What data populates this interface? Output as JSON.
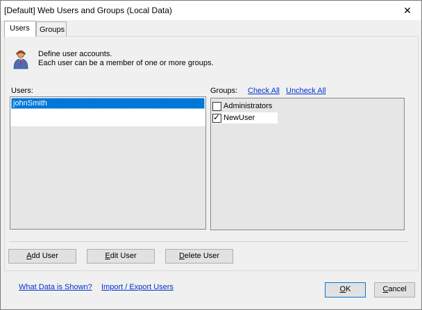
{
  "window": {
    "title": "[Default] Web Users and Groups (Local Data)",
    "close_glyph": "✕"
  },
  "tabs": [
    {
      "label": "Users",
      "active": true
    },
    {
      "label": "Groups",
      "active": false
    }
  ],
  "description": {
    "line1": "Define user accounts.",
    "line2": "Each user can be a member of one or more groups."
  },
  "users": {
    "label": "Users:",
    "items": [
      "johnSmith"
    ],
    "selected": "johnSmith"
  },
  "groups": {
    "label": "Groups:",
    "check_all": "Check All",
    "uncheck_all": "Uncheck All",
    "items": [
      {
        "label": "Administrators",
        "checked": false
      },
      {
        "label": "NewUser",
        "checked": true
      }
    ]
  },
  "buttons": {
    "add_user_pre": "",
    "add_user_ul": "A",
    "add_user_post": "dd User",
    "edit_user_pre": "",
    "edit_user_ul": "E",
    "edit_user_post": "dit User",
    "delete_user_pre": "",
    "delete_user_ul": "D",
    "delete_user_post": "elete User",
    "ok_ul": "O",
    "ok_post": "K",
    "cancel_pre": "",
    "cancel_ul": "C",
    "cancel_post": "ancel"
  },
  "links": {
    "what_data": "What Data is Shown?",
    "import_export": "Import / Export Users"
  },
  "colors": {
    "selection": "#0078d7",
    "link": "#0033cc"
  }
}
